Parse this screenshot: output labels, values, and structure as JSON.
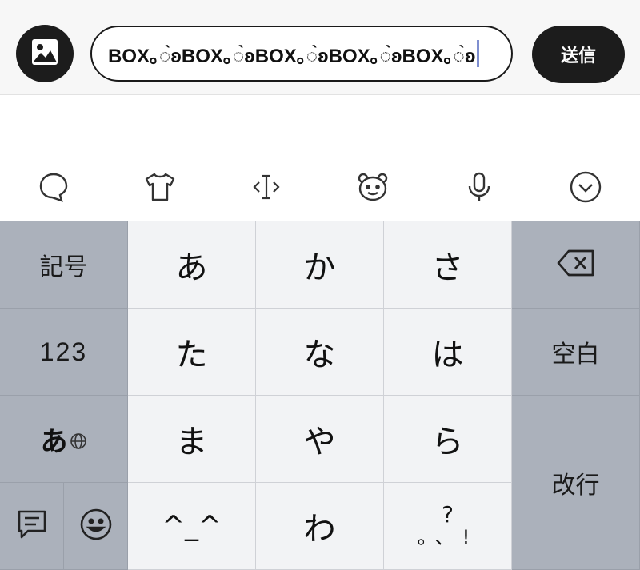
{
  "input_bar": {
    "message_text": "BOX｡◌̀ʚBOX｡◌̀ʚBOX｡◌̀ʚBOX｡◌̀ʚBOX｡◌̀ʚ",
    "send_label": "送信"
  },
  "toolbar": {
    "icons": [
      "chat-bubble-icon",
      "tshirt-icon",
      "cursor-move-icon",
      "bear-face-icon",
      "microphone-icon",
      "chevron-down-circle-icon"
    ]
  },
  "keyboard": {
    "left": {
      "symbols": "記号",
      "numbers": "123",
      "kana_mode": "あ"
    },
    "kana": {
      "a": "あ",
      "ka": "か",
      "sa": "さ",
      "ta": "た",
      "na": "な",
      "ha": "は",
      "ma": "ま",
      "ya": "や",
      "ra": "ら",
      "face": "^_^",
      "wa": "わ"
    },
    "punct": {
      "q": "?",
      "marks": "。、!"
    },
    "right": {
      "space": "空白",
      "enter": "改行"
    }
  },
  "colors": {
    "dark_button": "#1c1c1c",
    "function_key": "#abb1bb",
    "letter_key": "#f2f3f5",
    "caret": "#7f8fd0"
  }
}
